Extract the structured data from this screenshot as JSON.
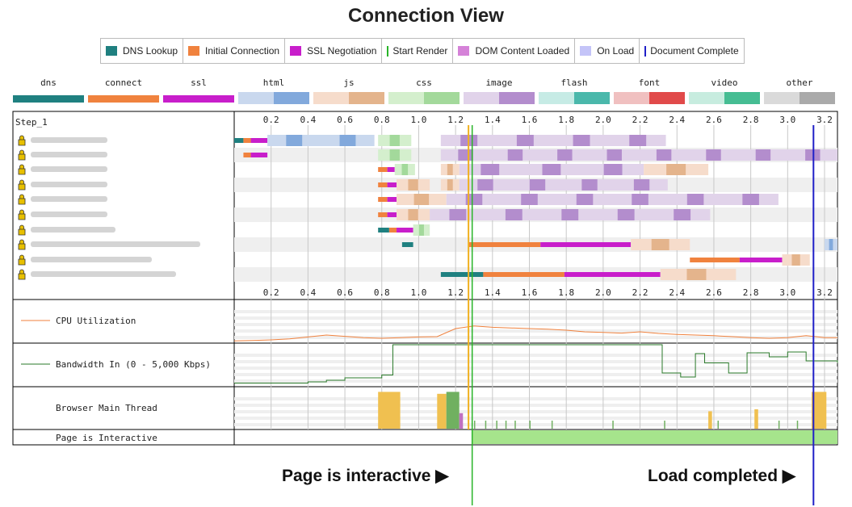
{
  "title": "Connection View",
  "legend": [
    {
      "label": "DNS Lookup",
      "color": "#1f8080",
      "kind": "box"
    },
    {
      "label": "Initial Connection",
      "color": "#f0823e",
      "kind": "box"
    },
    {
      "label": "SSL Negotiation",
      "color": "#c81ecb",
      "kind": "box"
    },
    {
      "label": "Start Render",
      "color": "#28b428",
      "kind": "line"
    },
    {
      "label": "DOM Content Loaded",
      "color": "#d582d8",
      "kind": "box"
    },
    {
      "label": "On Load",
      "color": "#c4c4f8",
      "kind": "box"
    },
    {
      "label": "Document Complete",
      "color": "#2020c8",
      "kind": "line"
    }
  ],
  "request_types": [
    {
      "label": "dns",
      "colors": [
        "#1f8080"
      ]
    },
    {
      "label": "connect",
      "colors": [
        "#f0823e"
      ]
    },
    {
      "label": "ssl",
      "colors": [
        "#c81ecb"
      ]
    },
    {
      "label": "html",
      "colors": [
        "#c9d8ee",
        "#82a9dc"
      ]
    },
    {
      "label": "js",
      "colors": [
        "#f6dccb",
        "#e4b48c"
      ]
    },
    {
      "label": "css",
      "colors": [
        "#d4efcd",
        "#a3d99b"
      ]
    },
    {
      "label": "image",
      "colors": [
        "#e1d3ea",
        "#b38dcd"
      ]
    },
    {
      "label": "flash",
      "colors": [
        "#c6ebe5",
        "#4ab8ab"
      ]
    },
    {
      "label": "font",
      "colors": [
        "#f0c0c0",
        "#e14a4a"
      ]
    },
    {
      "label": "video",
      "colors": [
        "#c7ecdf",
        "#46bd93"
      ]
    },
    {
      "label": "other",
      "colors": [
        "#dadada",
        "#aaaaaa"
      ]
    }
  ],
  "step_label": "Step_1",
  "metric_labels": {
    "cpu": "CPU Utilization",
    "bandwidth": "Bandwidth In (0 - 5,000 Kbps)",
    "main_thread": "Browser Main Thread",
    "interactive": "Page is Interactive"
  },
  "annotations": {
    "interactive": "Page is interactive",
    "load": "Load completed"
  },
  "chart_data": {
    "type": "waterfall",
    "x_ticks": [
      "0.2",
      "0.4",
      "0.6",
      "0.8",
      "1.0",
      "1.2",
      "1.4",
      "1.6",
      "1.8",
      "2.0",
      "2.2",
      "2.4",
      "2.6",
      "2.8",
      "3.0",
      "3.2"
    ],
    "xlim": [
      0.0,
      3.27
    ],
    "markers": {
      "start_render": 1.29,
      "dom_content_loaded": 1.27,
      "document_complete": 3.14
    },
    "connections": [
      {
        "row": 1,
        "segments": [
          {
            "t": "dns",
            "s": 0.0,
            "e": 0.05
          },
          {
            "t": "connect",
            "s": 0.05,
            "e": 0.09
          },
          {
            "t": "ssl",
            "s": 0.09,
            "e": 0.18
          },
          {
            "t": "html",
            "s": 0.18,
            "e": 0.76
          },
          {
            "t": "css",
            "s": 0.78,
            "e": 0.96
          },
          {
            "t": "image",
            "s": 1.12,
            "e": 2.34
          }
        ]
      },
      {
        "row": 2,
        "segments": [
          {
            "t": "connect",
            "s": 0.05,
            "e": 0.09
          },
          {
            "t": "ssl",
            "s": 0.09,
            "e": 0.18
          },
          {
            "t": "css",
            "s": 0.78,
            "e": 0.96
          },
          {
            "t": "image",
            "s": 1.12,
            "e": 3.27
          }
        ]
      },
      {
        "row": 3,
        "segments": [
          {
            "t": "connect",
            "s": 0.78,
            "e": 0.83
          },
          {
            "t": "ssl",
            "s": 0.83,
            "e": 0.87
          },
          {
            "t": "css",
            "s": 0.87,
            "e": 0.98
          },
          {
            "t": "js",
            "s": 1.12,
            "e": 1.22
          },
          {
            "t": "image",
            "s": 1.22,
            "e": 2.22
          },
          {
            "t": "js",
            "s": 2.22,
            "e": 2.57
          }
        ]
      },
      {
        "row": 4,
        "segments": [
          {
            "t": "connect",
            "s": 0.78,
            "e": 0.83
          },
          {
            "t": "ssl",
            "s": 0.83,
            "e": 0.88
          },
          {
            "t": "js",
            "s": 0.88,
            "e": 1.06
          },
          {
            "t": "js",
            "s": 1.12,
            "e": 1.22
          },
          {
            "t": "image",
            "s": 1.22,
            "e": 2.35
          }
        ]
      },
      {
        "row": 5,
        "segments": [
          {
            "t": "connect",
            "s": 0.78,
            "e": 0.83
          },
          {
            "t": "ssl",
            "s": 0.83,
            "e": 0.88
          },
          {
            "t": "js",
            "s": 0.88,
            "e": 1.15
          },
          {
            "t": "image",
            "s": 1.15,
            "e": 2.95
          }
        ]
      },
      {
        "row": 6,
        "segments": [
          {
            "t": "connect",
            "s": 0.78,
            "e": 0.83
          },
          {
            "t": "ssl",
            "s": 0.83,
            "e": 0.88
          },
          {
            "t": "js",
            "s": 0.88,
            "e": 1.06
          },
          {
            "t": "image",
            "s": 1.06,
            "e": 2.58
          }
        ]
      },
      {
        "row": 7,
        "segments": [
          {
            "t": "dns",
            "s": 0.78,
            "e": 0.84
          },
          {
            "t": "connect",
            "s": 0.84,
            "e": 0.88
          },
          {
            "t": "ssl",
            "s": 0.88,
            "e": 0.97
          },
          {
            "t": "css",
            "s": 0.97,
            "e": 1.06
          }
        ]
      },
      {
        "row": 8,
        "segments": [
          {
            "t": "dns",
            "s": 0.91,
            "e": 0.97
          },
          {
            "t": "connect",
            "s": 1.27,
            "e": 1.66
          },
          {
            "t": "ssl",
            "s": 1.66,
            "e": 2.15
          },
          {
            "t": "js",
            "s": 2.15,
            "e": 2.47
          },
          {
            "t": "html",
            "s": 3.2,
            "e": 3.27
          }
        ]
      },
      {
        "row": 9,
        "segments": [
          {
            "t": "connect",
            "s": 2.47,
            "e": 2.74
          },
          {
            "t": "ssl",
            "s": 2.74,
            "e": 2.97
          },
          {
            "t": "js",
            "s": 2.97,
            "e": 3.12
          }
        ]
      },
      {
        "row": 10,
        "segments": [
          {
            "t": "dns",
            "s": 1.12,
            "e": 1.35
          },
          {
            "t": "connect",
            "s": 1.35,
            "e": 1.79
          },
          {
            "t": "ssl",
            "s": 1.79,
            "e": 2.31
          },
          {
            "t": "js",
            "s": 2.31,
            "e": 2.72
          }
        ]
      }
    ],
    "cpu_series": [
      {
        "x": 0.0,
        "y": 2
      },
      {
        "x": 0.1,
        "y": 3
      },
      {
        "x": 0.2,
        "y": 5
      },
      {
        "x": 0.3,
        "y": 8
      },
      {
        "x": 0.4,
        "y": 14
      },
      {
        "x": 0.5,
        "y": 20
      },
      {
        "x": 0.6,
        "y": 16
      },
      {
        "x": 0.7,
        "y": 12
      },
      {
        "x": 0.8,
        "y": 10
      },
      {
        "x": 0.9,
        "y": 12
      },
      {
        "x": 1.0,
        "y": 14
      },
      {
        "x": 1.1,
        "y": 15
      },
      {
        "x": 1.2,
        "y": 40
      },
      {
        "x": 1.3,
        "y": 48
      },
      {
        "x": 1.4,
        "y": 44
      },
      {
        "x": 1.5,
        "y": 42
      },
      {
        "x": 1.6,
        "y": 40
      },
      {
        "x": 1.7,
        "y": 38
      },
      {
        "x": 1.8,
        "y": 35
      },
      {
        "x": 1.9,
        "y": 30
      },
      {
        "x": 2.0,
        "y": 28
      },
      {
        "x": 2.1,
        "y": 26
      },
      {
        "x": 2.2,
        "y": 30
      },
      {
        "x": 2.3,
        "y": 25
      },
      {
        "x": 2.4,
        "y": 22
      },
      {
        "x": 2.5,
        "y": 20
      },
      {
        "x": 2.6,
        "y": 18
      },
      {
        "x": 2.7,
        "y": 15
      },
      {
        "x": 2.8,
        "y": 12
      },
      {
        "x": 2.9,
        "y": 10
      },
      {
        "x": 3.0,
        "y": 12
      },
      {
        "x": 3.1,
        "y": 18
      },
      {
        "x": 3.2,
        "y": 12
      },
      {
        "x": 3.27,
        "y": 12
      }
    ],
    "bandwidth_series": [
      {
        "x": 0.0,
        "y": 5
      },
      {
        "x": 0.4,
        "y": 8
      },
      {
        "x": 0.5,
        "y": 12
      },
      {
        "x": 0.6,
        "y": 18
      },
      {
        "x": 0.8,
        "y": 25
      },
      {
        "x": 0.86,
        "y": 100
      },
      {
        "x": 2.3,
        "y": 100
      },
      {
        "x": 2.32,
        "y": 30
      },
      {
        "x": 2.42,
        "y": 20
      },
      {
        "x": 2.5,
        "y": 78
      },
      {
        "x": 2.55,
        "y": 55
      },
      {
        "x": 2.68,
        "y": 30
      },
      {
        "x": 2.78,
        "y": 80
      },
      {
        "x": 2.9,
        "y": 70
      },
      {
        "x": 3.0,
        "y": 82
      },
      {
        "x": 3.1,
        "y": 60
      },
      {
        "x": 3.27,
        "y": 55
      }
    ],
    "main_thread": [
      {
        "s": 0.78,
        "e": 0.9,
        "h": 95,
        "color": "#f0c050"
      },
      {
        "s": 1.1,
        "e": 1.15,
        "h": 90,
        "color": "#f0c050"
      },
      {
        "s": 1.15,
        "e": 1.22,
        "h": 95,
        "color": "#70b060"
      },
      {
        "s": 1.22,
        "e": 1.24,
        "h": 40,
        "color": "#c070c0"
      },
      {
        "s": 2.57,
        "e": 2.59,
        "h": 45,
        "color": "#f0c050"
      },
      {
        "s": 2.82,
        "e": 2.84,
        "h": 50,
        "color": "#f0c050"
      },
      {
        "s": 3.13,
        "e": 3.21,
        "h": 95,
        "color": "#f0c050"
      }
    ],
    "interactive": {
      "from": 1.29,
      "to": 3.27
    }
  }
}
